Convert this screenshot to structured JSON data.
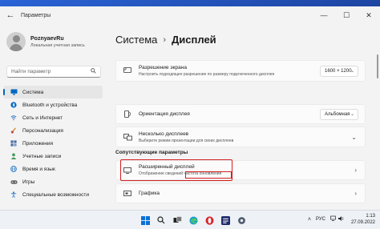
{
  "window": {
    "title": "Параметры",
    "back_glyph": "←",
    "controls": {
      "minimize": "—",
      "maximize": "☐",
      "close": "✕"
    }
  },
  "profile": {
    "name": "PoznyaevRu",
    "subtitle": "Локальная учетная запись"
  },
  "search": {
    "placeholder": "Найти параметр",
    "icon": "search-icon"
  },
  "sidebar": {
    "items": [
      {
        "label": "Система",
        "icon": "monitor-icon",
        "active": true,
        "color": "#0067c0"
      },
      {
        "label": "Bluetooth и устройства",
        "icon": "bluetooth-icon",
        "color": "#0067c0"
      },
      {
        "label": "Сеть и Интернет",
        "icon": "network-icon",
        "color": "#2a6fb5"
      },
      {
        "label": "Персонализация",
        "icon": "brush-icon",
        "color": "#d28d2a"
      },
      {
        "label": "Приложения",
        "icon": "apps-icon",
        "color": "#4a6fa5"
      },
      {
        "label": "Учетные записи",
        "icon": "person-icon",
        "color": "#3d9a54"
      },
      {
        "label": "Время и язык",
        "icon": "globe-icon",
        "color": "#2a79c4"
      },
      {
        "label": "Игры",
        "icon": "gamepad-icon",
        "color": "#666666"
      },
      {
        "label": "Специальные возможности",
        "icon": "accessibility-icon",
        "color": "#2a79c4"
      }
    ]
  },
  "breadcrumb": {
    "parent": "Система",
    "separator": "›",
    "current": "Дисплей"
  },
  "cards": {
    "resolution": {
      "title": "Разрешение экрана",
      "subtitle": "Настроить подходящее разрешение по размеру подключенного дисплея",
      "value": "1600 × 1200"
    },
    "orientation": {
      "title": "Ориентация дисплея",
      "value": "Альбомная"
    },
    "multiple": {
      "title": "Несколько дисплеев",
      "subtitle": "Выберите режим презентации для своих дисплеев"
    },
    "advanced": {
      "title": "Расширенный дисплей",
      "subtitle_a": "Отображение сведений",
      "subtitle_b": "частота обновления"
    },
    "graphics": {
      "title": "Графика"
    }
  },
  "section": {
    "related": "Сопутствующие параметры"
  },
  "taskbar": {
    "apps": [
      "windows-start-icon",
      "search-icon",
      "task-view-icon",
      "edge-icon",
      "opera-icon",
      "tasks-icon",
      "settings-icon"
    ],
    "tray": {
      "chevron": "˄",
      "language": "РУС",
      "time": "1:13",
      "date": "27.09.2022"
    }
  },
  "colors": {
    "accent": "#0067c0",
    "highlight": "#d32020",
    "window_bg": "#f3f3f3"
  }
}
